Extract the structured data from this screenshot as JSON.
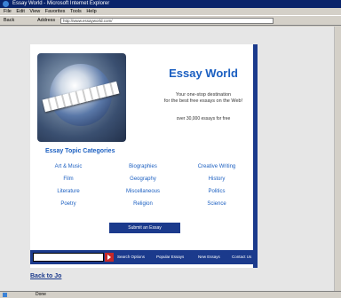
{
  "window": {
    "title": "Essay World - Microsoft Internet Explorer"
  },
  "menu": [
    "File",
    "Edit",
    "View",
    "Favorites",
    "Tools",
    "Help"
  ],
  "toolbar": {
    "back_label": "Back",
    "address_label": "Address",
    "address_value": "http://www.essayworld.com/"
  },
  "site": {
    "title": "Essay World",
    "tagline_line1": "Your one-stop destination",
    "tagline_line2": "for the best free essays on the Web!",
    "essay_count": "over 30,000 essays for free"
  },
  "categories": {
    "heading": "Essay Topic Categories",
    "col1": [
      "Art & Music",
      "Film",
      "Literature",
      "Poetry"
    ],
    "col2": [
      "Biographies",
      "Geography",
      "Miscellaneous",
      "Religion"
    ],
    "col3": [
      "Creative Writing",
      "History",
      "Politics",
      "Science"
    ]
  },
  "submit_label": "Submit an Essay",
  "bottom_links": [
    "Search Options",
    "Popular Essays",
    "New Essays",
    "Contact Us"
  ],
  "back_link": "Back to Jo",
  "status": {
    "text": "Done"
  }
}
